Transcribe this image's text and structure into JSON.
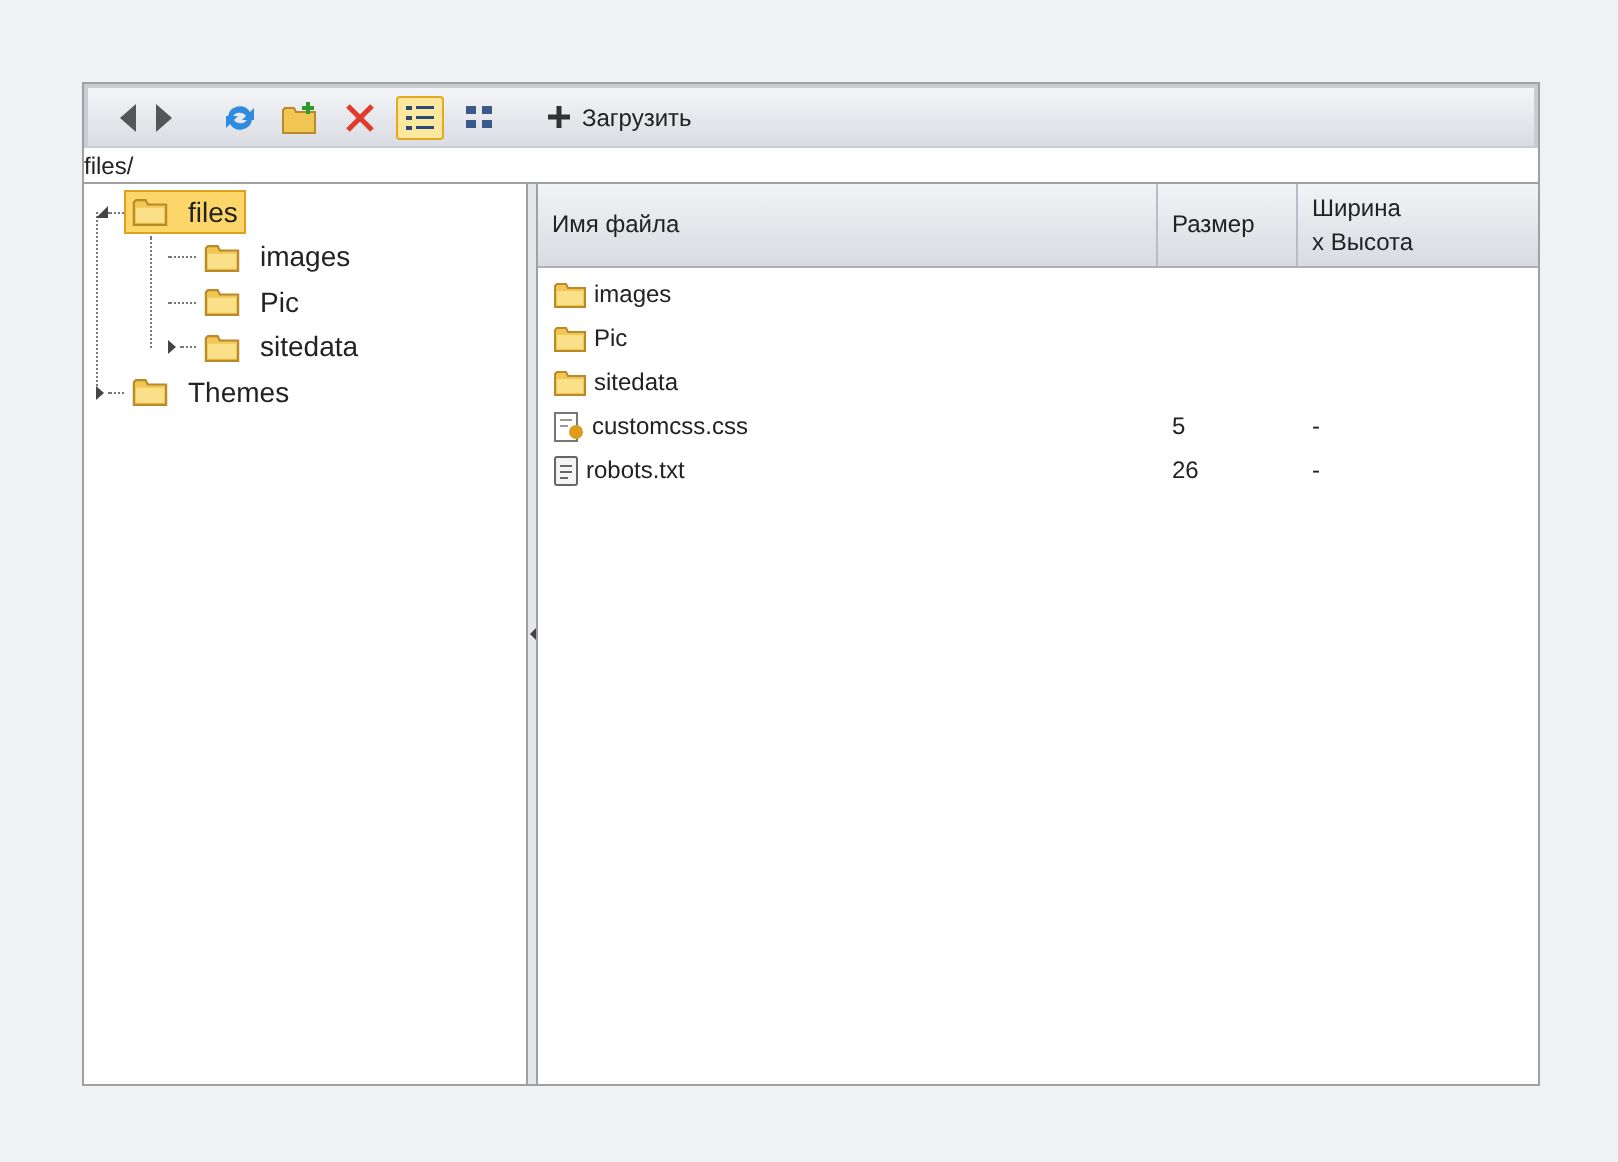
{
  "toolbar": [
    {
      "kind": "back"
    },
    {
      "kind": "forward"
    },
    {
      "kind": "refresh"
    },
    {
      "kind": "new-folder"
    },
    {
      "kind": "delete"
    },
    {
      "kind": "list-view",
      "selected": true
    },
    {
      "kind": "thumbnail-view",
      "selected": false
    },
    {
      "kind": "upload",
      "label": "Загрузить"
    }
  ],
  "path": "files/",
  "tree": [
    {
      "label": "files",
      "selected": true,
      "expandable": true,
      "expanded": true,
      "children": [
        {
          "label": "images",
          "selected": false,
          "expandable": false
        },
        {
          "label": "Pic",
          "selected": false,
          "expandable": false
        },
        {
          "label": "sitedata",
          "selected": false,
          "expandable": true,
          "expanded": false
        }
      ]
    },
    {
      "label": "Themes",
      "selected": false,
      "expandable": true,
      "expanded": false
    }
  ],
  "table": {
    "columns": [
      "Имя файла",
      "Размер",
      "Ширина x Высота"
    ],
    "rows": [
      {
        "kind": "folder",
        "name": "images"
      },
      {
        "kind": "folder",
        "name": "Pic"
      },
      {
        "kind": "folder",
        "name": "sitedata"
      },
      {
        "kind": "css",
        "name": "customcss.css",
        "size": "5",
        "dimensions": "-"
      },
      {
        "kind": "text",
        "name": "robots.txt",
        "size": "26",
        "dimensions": "-"
      }
    ]
  }
}
